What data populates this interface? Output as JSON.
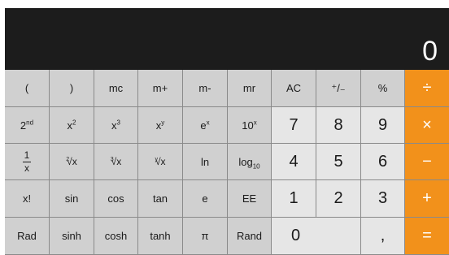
{
  "display": {
    "value": "0"
  },
  "keys": {
    "open_paren": "(",
    "close_paren": ")",
    "mc": "mc",
    "m_plus": "m+",
    "m_minus": "m-",
    "mr": "mr",
    "ac": "AC",
    "plus_minus": "⁺/₋",
    "percent": "%",
    "divide": "÷",
    "second_base": "2",
    "second_sup": "nd",
    "x_base": "x",
    "sq_sup": "2",
    "cube_sup": "3",
    "pow_y_sup": "y",
    "e_base": "e",
    "ten_base": "10",
    "exp_x_sup": "x",
    "seven": "7",
    "eight": "8",
    "nine": "9",
    "multiply": "×",
    "frac_num": "1",
    "frac_den": "x",
    "sqrt_idx": "2",
    "cbrt_idx": "3",
    "yroot_idx": "y",
    "root_rad": "√x",
    "ln": "ln",
    "log_base": "log",
    "log_sub": "10",
    "four": "4",
    "five": "5",
    "six": "6",
    "minus": "−",
    "factorial": "x!",
    "sin": "sin",
    "cos": "cos",
    "tan": "tan",
    "e": "e",
    "ee": "EE",
    "one": "1",
    "two": "2",
    "three": "3",
    "plus": "+",
    "rad": "Rad",
    "sinh": "sinh",
    "cosh": "cosh",
    "tanh": "tanh",
    "pi": "π",
    "rand": "Rand",
    "zero": "0",
    "decimal": ",",
    "equals": "="
  }
}
